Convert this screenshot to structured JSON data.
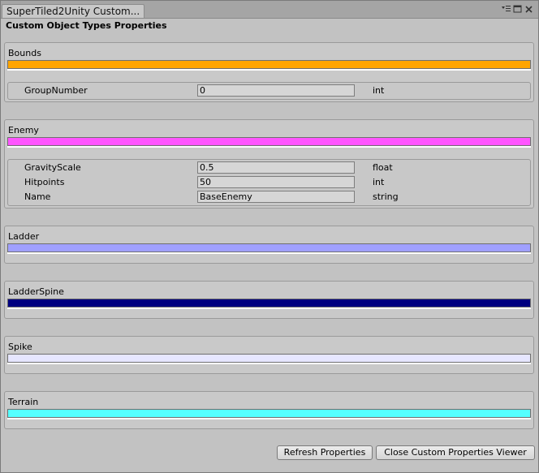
{
  "window": {
    "tab_title": "SuperTiled2Unity Custom...",
    "controls": [
      "menu-icon",
      "maximize-icon",
      "close-icon"
    ]
  },
  "heading": "Custom Object Types Properties",
  "object_types": [
    {
      "name": "Bounds",
      "color": "#ffa500",
      "properties": [
        {
          "name": "GroupNumber",
          "value": "0",
          "type": "int"
        }
      ]
    },
    {
      "name": "Enemy",
      "color": "#ff55ff",
      "properties": [
        {
          "name": "GravityScale",
          "value": "0.5",
          "type": "float"
        },
        {
          "name": "Hitpoints",
          "value": "50",
          "type": "int"
        },
        {
          "name": "Name",
          "value": "BaseEnemy",
          "type": "string"
        }
      ]
    },
    {
      "name": "Ladder",
      "color": "#a0a0ff",
      "properties": []
    },
    {
      "name": "LadderSpine",
      "color": "#000080",
      "properties": []
    },
    {
      "name": "Spike",
      "color": "#e6e6ff",
      "properties": []
    },
    {
      "name": "Terrain",
      "color": "#55ffff",
      "properties": []
    }
  ],
  "buttons": {
    "refresh": "Refresh Properties",
    "close": "Close Custom Properties Viewer"
  }
}
